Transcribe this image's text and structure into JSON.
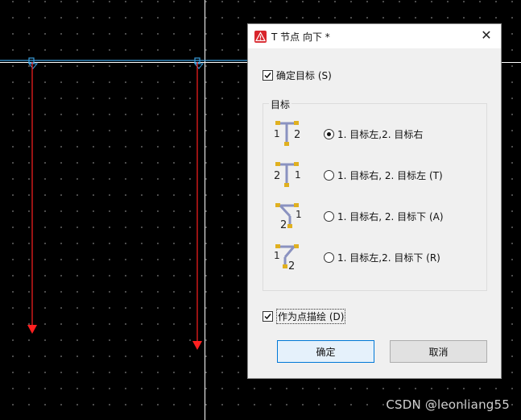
{
  "dialog": {
    "title": "T 节点 向下 *",
    "close_glyph": "✕",
    "confirm_target": {
      "label": "确定目标 (S)",
      "checked": true
    },
    "target_group": {
      "title": "目标",
      "options": [
        {
          "label": "1. 目标左,2. 目标右",
          "selected": true,
          "icon": "t-junction-left-right-icon"
        },
        {
          "label": "1. 目标右, 2. 目标左 (T)",
          "selected": false,
          "icon": "t-junction-right-left-icon"
        },
        {
          "label": "1. 目标右, 2. 目标下 (A)",
          "selected": false,
          "icon": "t-junction-right-down-icon"
        },
        {
          "label": "1. 目标左,2. 目标下 (R)",
          "selected": false,
          "icon": "t-junction-left-down-icon"
        }
      ]
    },
    "draw_as_point": {
      "label": "作为点描绘 (D)",
      "checked": true
    },
    "ok_label": "确定",
    "cancel_label": "取消"
  },
  "watermark": "CSDN @leonliang55",
  "colors": {
    "canvas_bg": "#000000",
    "grid_dot": "#5a5a5a",
    "vertical_line": "#ff2020",
    "horizontal_line": "#3aa0e0",
    "crosshair": "#ffffff",
    "accent": "#0078d7",
    "icon_line": "#8a92c0",
    "icon_marker": "#e0b020"
  }
}
